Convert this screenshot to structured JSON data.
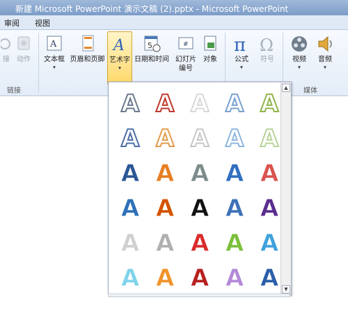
{
  "window": {
    "title": "新建 Microsoft PowerPoint 演示文稿 (2).pptx - Microsoft PowerPoint"
  },
  "menu": {
    "items": [
      "审阅",
      "视图"
    ]
  },
  "ribbon": {
    "buttons": {
      "hyperlink": "接",
      "action": "动作",
      "textbox": "文本框",
      "header_footer": "页眉和页脚",
      "wordart": "艺术字",
      "datetime": "日期和时间",
      "slide_number_1": "幻灯片",
      "slide_number_2": "编号",
      "object": "对象",
      "equation": "公式",
      "symbol": "符号",
      "video": "视频",
      "audio": "音频"
    },
    "groups": {
      "links": "链接",
      "media": "媒体"
    }
  },
  "wordart_gallery": {
    "styles": [
      [
        "outline-gray",
        "outline-red",
        "outline-light",
        "outline-blue",
        "olive-green"
      ],
      [
        "shadow-blue",
        "outline-orange",
        "outline-gray-2",
        "outline-lightblue",
        "light-green"
      ],
      [
        "blue-gradient",
        "orange-gradient",
        "gray-gradient",
        "blue-bold",
        "red-outline"
      ],
      [
        "blue-bevel",
        "orange-bevel",
        "black-white",
        "blue-reflect",
        "purple-bevel"
      ],
      [
        "light-gray",
        "silver",
        "red-gradient",
        "green-gradient",
        "cyan-reflect"
      ],
      [
        "cyan-glow",
        "orange-glow",
        "dark-red",
        "lavender",
        "blue-reflection"
      ]
    ],
    "glyph": "A",
    "colors": {
      "row1": [
        "#6b7a8f",
        "#c0392b",
        "#d8d8d8",
        "#7aa2cf",
        "#8fb54a"
      ],
      "row2": [
        "#4e6fa8",
        "#e39b4c",
        "#c7c7c7",
        "#8fb7e0",
        "#b8d39a"
      ],
      "row3": [
        "#2b5794",
        "#e67e22",
        "#7f8c8d",
        "#2f6fc0",
        "#d9534f"
      ],
      "row4": [
        "#2e70b8",
        "#d35400",
        "#111111",
        "#3d72b8",
        "#5b2d8e"
      ],
      "row5": [
        "#d0d0d0",
        "#b0b0b0",
        "#d92b2b",
        "#7cbf3a",
        "#3fa2dc"
      ],
      "row6": [
        "#7fd3ea",
        "#f0932b",
        "#b81f1f",
        "#b48ad8",
        "#2a5fa8"
      ]
    }
  }
}
